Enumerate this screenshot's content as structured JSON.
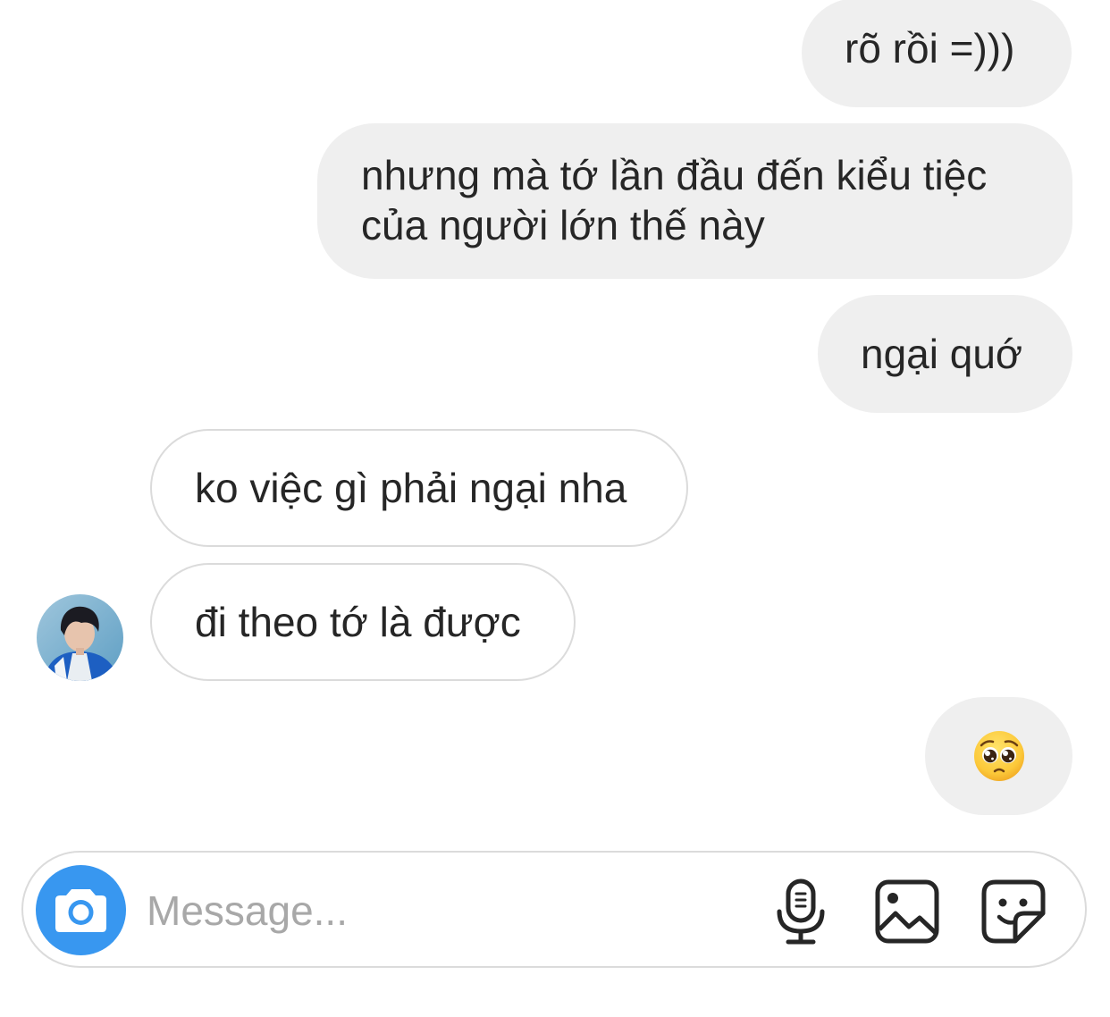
{
  "messages": [
    {
      "id": "b1",
      "direction": "sent",
      "lines": [
        "rõ rồi =)))"
      ]
    },
    {
      "id": "b2",
      "direction": "sent",
      "lines": [
        "nhưng mà tớ lần đầu đến kiểu tiệc",
        "của người lớn thế này"
      ]
    },
    {
      "id": "b3",
      "direction": "sent",
      "lines": [
        "ngại quớ"
      ]
    },
    {
      "id": "b4",
      "direction": "received",
      "lines": [
        "ko việc gì phải ngại nha"
      ]
    },
    {
      "id": "b5",
      "direction": "received",
      "lines": [
        "đi theo tớ là được"
      ]
    },
    {
      "id": "b6",
      "direction": "sent",
      "emoji": "pleading-face-emoji"
    }
  ],
  "contact": {
    "avatar": "contact-avatar"
  },
  "composer": {
    "placeholder": "Message...",
    "value": "",
    "camera_icon": "camera-icon",
    "mic_icon": "microphone-icon",
    "gallery_icon": "image-gallery-icon",
    "sticker_icon": "sticker-icon",
    "accent_color": "#3897f0"
  },
  "colors": {
    "sent_bubble": "#efefef",
    "received_bubble_border": "#dbdbdb",
    "text": "#262626",
    "placeholder": "#a8a8a8"
  }
}
